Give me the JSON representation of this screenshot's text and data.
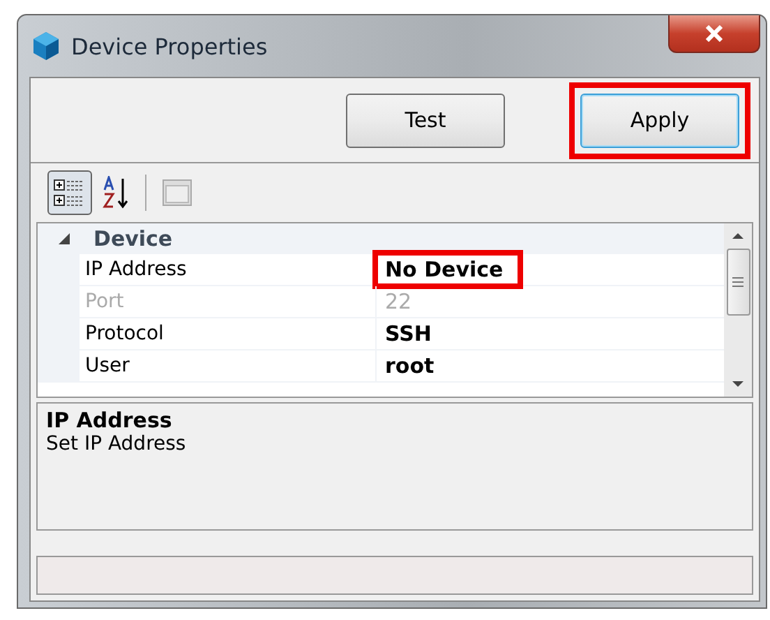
{
  "window": {
    "title": "Device Properties"
  },
  "buttons": [
    {
      "label": "Test",
      "highlighted": false
    },
    {
      "label": "Apply",
      "highlighted": true
    }
  ],
  "toolbar": [
    {
      "kind": "categorized",
      "selected": true
    },
    {
      "kind": "alphabetical",
      "selected": false
    },
    {
      "kind": "pages",
      "selected": false
    }
  ],
  "grid": {
    "category": "Device",
    "expanded": true,
    "rows": [
      {
        "label": "IP Address",
        "value": "No Device",
        "disabled": false,
        "highlighted": true
      },
      {
        "label": "Port",
        "value": "22",
        "disabled": true,
        "highlighted": false
      },
      {
        "label": "Protocol",
        "value": "SSH",
        "disabled": false,
        "highlighted": false
      },
      {
        "label": "User",
        "value": "root",
        "disabled": false,
        "highlighted": false
      }
    ]
  },
  "description": {
    "title": "IP Address",
    "text": "Set IP Address"
  }
}
